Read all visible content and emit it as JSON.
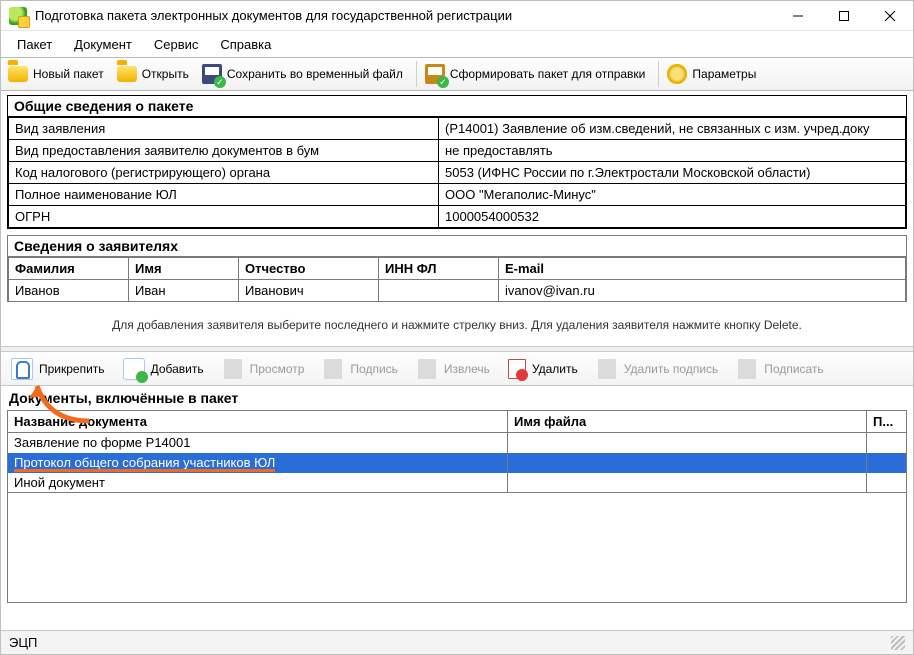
{
  "window": {
    "title": "Подготовка пакета электронных документов для государственной регистрации"
  },
  "menu": {
    "package": "Пакет",
    "document": "Документ",
    "service": "Сервис",
    "help": "Справка"
  },
  "toolbar": {
    "new_package": "Новый пакет",
    "open": "Открыть",
    "save_temp": "Сохранить во временный файл",
    "form_package": "Сформировать пакет для отправки",
    "params": "Параметры"
  },
  "general": {
    "header": "Общие сведения о пакете",
    "rows": [
      {
        "label": "Вид заявления",
        "value": "(Р14001) Заявление об изм.сведений, не связанных с изм. учред.доку"
      },
      {
        "label": "Вид предоставления заявителю документов в бум",
        "value": "не предоставлять"
      },
      {
        "label": "Код налогового (регистрирующего) органа",
        "value": "5053 (ИФНС России по г.Электростали Московской области)"
      },
      {
        "label": "Полное наименование ЮЛ",
        "value": "ООО \"Мегаполис-Минус\""
      },
      {
        "label": "ОГРН",
        "value": "1000054000532"
      }
    ]
  },
  "applicants": {
    "header": "Сведения о заявителях",
    "columns": {
      "lastname": "Фамилия",
      "firstname": "Имя",
      "patronymic": "Отчество",
      "inn": "ИНН ФЛ",
      "email": "E-mail"
    },
    "rows": [
      {
        "lastname": "Иванов",
        "firstname": "Иван",
        "patronymic": "Иванович",
        "inn": "",
        "email": "ivanov@ivan.ru"
      }
    ],
    "hint": "Для добавления заявителя выберите последнего и нажмите стрелку вниз. Для удаления заявителя нажмите кнопку Delete."
  },
  "doc_toolbar": {
    "attach": "Прикрепить",
    "add": "Добавить",
    "view": "Просмотр",
    "signature": "Подпись",
    "extract": "Извлечь",
    "delete": "Удалить",
    "delete_sig": "Удалить подпись",
    "sign": "Подписать"
  },
  "docs": {
    "header": "Документы, включённые в пакет",
    "columns": {
      "name": "Название документа",
      "filename": "Имя файла",
      "p": "П..."
    },
    "rows": [
      {
        "name": "Заявление по форме Р14001",
        "filename": "",
        "selected": false
      },
      {
        "name": "Протокол общего собрания участников ЮЛ",
        "filename": "",
        "selected": true
      },
      {
        "name": "Иной документ",
        "filename": "",
        "selected": false
      }
    ]
  },
  "status": {
    "label": "ЭЦП"
  }
}
